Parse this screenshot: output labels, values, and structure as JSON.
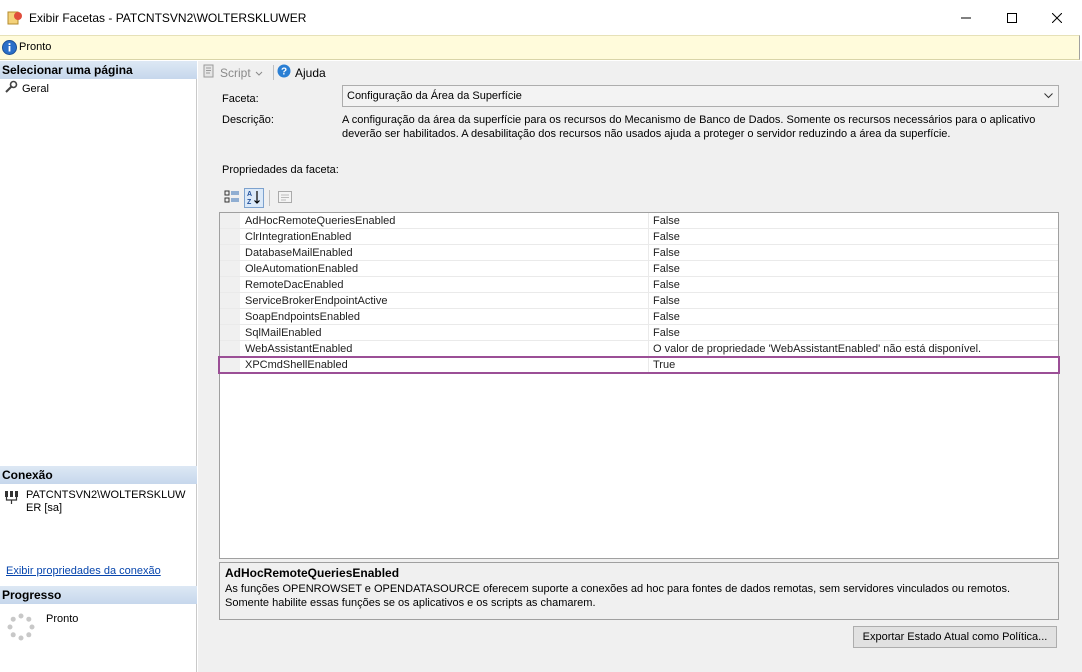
{
  "window": {
    "title": "Exibir Facetas - PATCNTSVN2\\WOLTERSKLUWER"
  },
  "status_bar": {
    "text": "Pronto"
  },
  "left_panel": {
    "select_page_header": "Selecionar uma página",
    "pages": [
      {
        "label": "Geral"
      }
    ],
    "connection_header": "Conexão",
    "connection_text": "PATCNTSVN2\\WOLTERSKLUWER [sa]",
    "connection_link": "Exibir propriedades da conexão",
    "progress_header": "Progresso",
    "progress_status": "Pronto"
  },
  "toolbar": {
    "script_label": "Script",
    "help_label": "Ajuda"
  },
  "form": {
    "facet_label": "Faceta:",
    "facet_value": "Configuração da Área da Superfície",
    "description_label": "Descrição:",
    "description_text": "A configuração da área da superfície para os recursos do Mecanismo de Banco de Dados. Somente os recursos necessários para o aplicativo deverão ser habilitados. A desabilitação dos recursos não usados ajuda a proteger o servidor reduzindo a área da superfície.",
    "properties_label": "Propriedades da faceta:"
  },
  "properties": [
    {
      "name": "AdHocRemoteQueriesEnabled",
      "value": "False"
    },
    {
      "name": "ClrIntegrationEnabled",
      "value": "False"
    },
    {
      "name": "DatabaseMailEnabled",
      "value": "False"
    },
    {
      "name": "OleAutomationEnabled",
      "value": "False"
    },
    {
      "name": "RemoteDacEnabled",
      "value": "False"
    },
    {
      "name": "ServiceBrokerEndpointActive",
      "value": "False"
    },
    {
      "name": "SoapEndpointsEnabled",
      "value": "False"
    },
    {
      "name": "SqlMailEnabled",
      "value": "False"
    },
    {
      "name": "WebAssistantEnabled",
      "value": "O valor de propriedade 'WebAssistantEnabled' não está disponível."
    },
    {
      "name": "XPCmdShellEnabled",
      "value": "True"
    }
  ],
  "highlight": {
    "color": "#9b4f96"
  },
  "property_description": {
    "title": "AdHocRemoteQueriesEnabled",
    "body": "As funções OPENROWSET e OPENDATASOURCE oferecem suporte a conexões ad hoc para fontes de dados remotas, sem servidores vinculados ou remotos. Somente habilite essas funções se os aplicativos e os scripts as chamarem."
  },
  "buttons": {
    "export_label": "Exportar Estado Atual como Política..."
  }
}
